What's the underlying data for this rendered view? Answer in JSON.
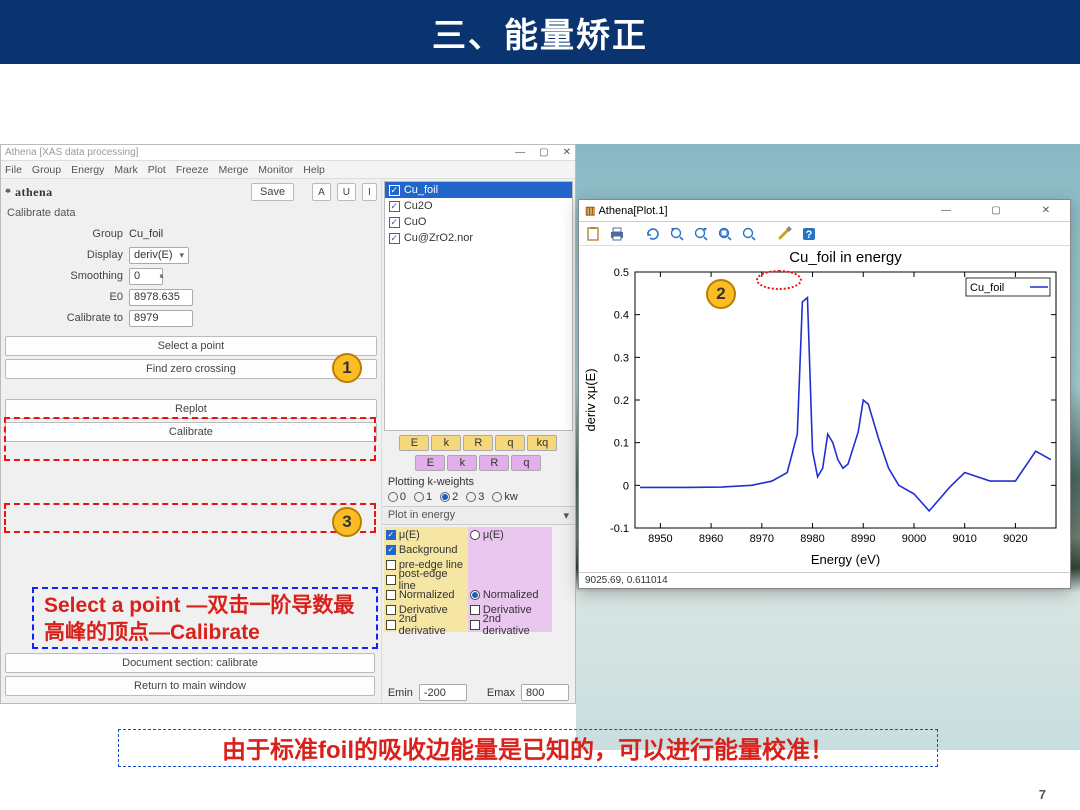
{
  "slide": {
    "title": "三、能量矫正",
    "page": "7",
    "note": "Select a point —双击一阶导数最高峰的顶点—Calibrate",
    "footnote": "由于标准foil的吸收边能量是已知的，可以进行能量校准！"
  },
  "athena": {
    "title": "Athena [XAS data processing]",
    "brand": "* athena",
    "menu": [
      "File",
      "Group",
      "Energy",
      "Mark",
      "Plot",
      "Freeze",
      "Merge",
      "Monitor",
      "Help"
    ],
    "save": "Save",
    "A": "A",
    "U": "U",
    "I": "I",
    "section": "Calibrate data",
    "form": {
      "group_lbl": "Group",
      "group_val": "Cu_foil",
      "display_lbl": "Display",
      "display_val": "deriv(E)",
      "smooth_lbl": "Smoothing",
      "smooth_val": "0",
      "e0_lbl": "E0",
      "e0_val": "8978.635",
      "calib_lbl": "Calibrate to",
      "calib_val": "8979"
    },
    "buttons": {
      "select": "Select a point",
      "zero": "Find zero crossing",
      "replot": "Replot",
      "calibrate": "Calibrate",
      "doc": "Document section: calibrate",
      "return": "Return to main window"
    },
    "groups": [
      {
        "name": "Cu_foil",
        "sel": true,
        "chk": true
      },
      {
        "name": "Cu2O",
        "sel": false,
        "chk": true
      },
      {
        "name": "CuO",
        "sel": false,
        "chk": true
      },
      {
        "name": "Cu@ZrO2.nor",
        "sel": false,
        "chk": true
      }
    ],
    "spaces1": [
      "E",
      "k",
      "R",
      "q",
      "kq"
    ],
    "spaces2": [
      "E",
      "k",
      "R",
      "q"
    ],
    "plot_kw_label": "Plotting k-weights",
    "kw": [
      "0",
      "1",
      "2",
      "3",
      "kw"
    ],
    "kw_sel": "2",
    "plot_in_e": "Plot in energy",
    "pe_left": [
      {
        "l": "μ(E)",
        "on": true
      },
      {
        "l": "Background",
        "on": true
      },
      {
        "l": "pre-edge line",
        "on": false
      },
      {
        "l": "post-edge line",
        "on": false
      },
      {
        "l": "Normalized",
        "on": false
      },
      {
        "l": "Derivative",
        "on": false
      },
      {
        "l": "2nd derivative",
        "on": false
      }
    ],
    "pe_right": [
      {
        "l": "μ(E)",
        "on": false,
        "r": true
      },
      {
        "l": "Normalized",
        "on": true,
        "r": true
      },
      {
        "l": "Derivative",
        "on": false
      },
      {
        "l": "2nd derivative",
        "on": false
      }
    ],
    "emin_lbl": "Emin",
    "emin_val": "-200",
    "emax_lbl": "Emax",
    "emax_val": "800"
  },
  "plot": {
    "wintitle": "Athena[Plot.1]",
    "title": "Cu_foil in energy",
    "xlabel": "Energy   (eV)",
    "ylabel": "deriv xμ(E)",
    "legend": "Cu_foil",
    "status": "9025.69,  0.611014",
    "callouts": {
      "1": "1",
      "2": "2",
      "3": "3"
    }
  },
  "chart_data": {
    "type": "line",
    "title": "Cu_foil in energy",
    "xlabel": "Energy (eV)",
    "ylabel": "deriv xμ(E)",
    "xlim": [
      8945,
      9028
    ],
    "ylim": [
      -0.1,
      0.5
    ],
    "xticks": [
      8950,
      8960,
      8970,
      8980,
      8990,
      9000,
      9010,
      9020
    ],
    "yticks": [
      -0.1,
      0,
      0.1,
      0.2,
      0.3,
      0.4,
      0.5
    ],
    "series": [
      {
        "name": "Cu_foil",
        "x": [
          8946,
          8955,
          8962,
          8968,
          8972,
          8975,
          8977,
          8978,
          8979,
          8980,
          8981,
          8982,
          8983,
          8984,
          8985,
          8986,
          8987,
          8989,
          8990,
          8991,
          8993,
          8995,
          8997,
          9000,
          9003,
          9007,
          9010,
          9015,
          9020,
          9024,
          9027
        ],
        "y": [
          -0.005,
          -0.005,
          -0.004,
          0.0,
          0.01,
          0.03,
          0.12,
          0.43,
          0.44,
          0.08,
          0.02,
          0.04,
          0.12,
          0.1,
          0.06,
          0.04,
          0.05,
          0.125,
          0.2,
          0.19,
          0.11,
          0.04,
          0.0,
          -0.02,
          -0.06,
          -0.005,
          0.03,
          0.01,
          0.01,
          0.08,
          0.06
        ]
      }
    ]
  }
}
